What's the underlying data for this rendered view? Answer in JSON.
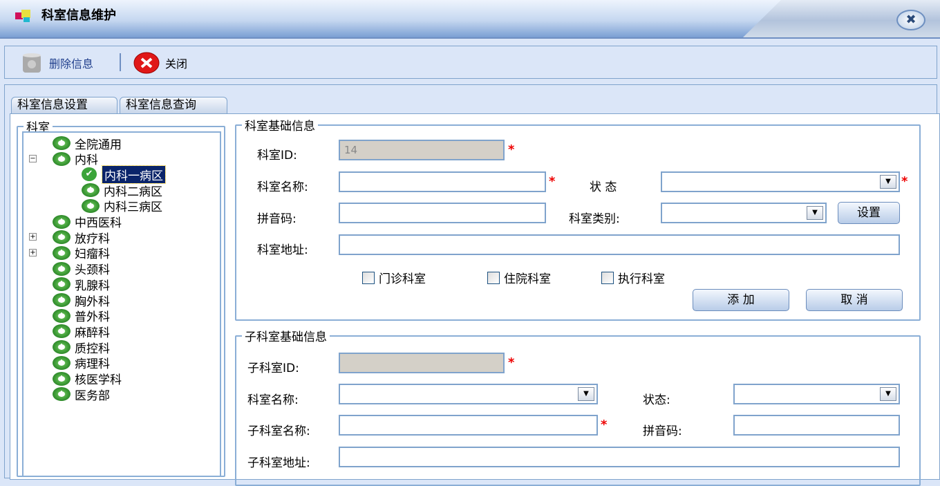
{
  "window": {
    "title": "科室信息维护",
    "close_icon": "close-icon"
  },
  "toolbar": {
    "delete_label": "删除信息",
    "close_label": "关闭"
  },
  "tabs": [
    {
      "label": "科室信息设置",
      "active": true
    },
    {
      "label": "科室信息查询",
      "active": false
    }
  ],
  "tree": {
    "legend": "科室",
    "nodes": [
      {
        "label": "全院通用",
        "level": 0
      },
      {
        "label": "内科",
        "level": 0,
        "expanded": true
      },
      {
        "label": "内科一病区",
        "level": 1,
        "selected": true
      },
      {
        "label": "内科二病区",
        "level": 1
      },
      {
        "label": "内科三病区",
        "level": 1
      },
      {
        "label": "中西医科",
        "level": 0
      },
      {
        "label": "放疗科",
        "level": 0,
        "collapsed": true
      },
      {
        "label": "妇瘤科",
        "level": 0,
        "collapsed": true
      },
      {
        "label": "头颈科",
        "level": 0
      },
      {
        "label": "乳腺科",
        "level": 0
      },
      {
        "label": "胸外科",
        "level": 0
      },
      {
        "label": "普外科",
        "level": 0
      },
      {
        "label": "麻醉科",
        "level": 0
      },
      {
        "label": "质控科",
        "level": 0
      },
      {
        "label": "病理科",
        "level": 0
      },
      {
        "label": "核医学科",
        "level": 0
      },
      {
        "label": "医务部",
        "level": 0
      }
    ]
  },
  "basic": {
    "legend": "科室基础信息",
    "id_label": "科室ID:",
    "id_value": "14",
    "name_label": "科室名称:",
    "status_label": "状 态",
    "pinyin_label": "拼音码:",
    "category_label": "科室类别:",
    "settings_btn": "设置",
    "address_label": "科室地址:",
    "checkboxes": [
      "门诊科室",
      "住院科室",
      "执行科室"
    ],
    "add_btn": "添 加",
    "cancel_btn": "取 消",
    "required": "*"
  },
  "sub": {
    "legend": "子科室基础信息",
    "id_label": "子科室ID:",
    "dept_label": "科室名称:",
    "status_label": "状态:",
    "name_label": "子科室名称:",
    "pinyin_label": "拼音码:",
    "address_label": "子科室地址:"
  }
}
